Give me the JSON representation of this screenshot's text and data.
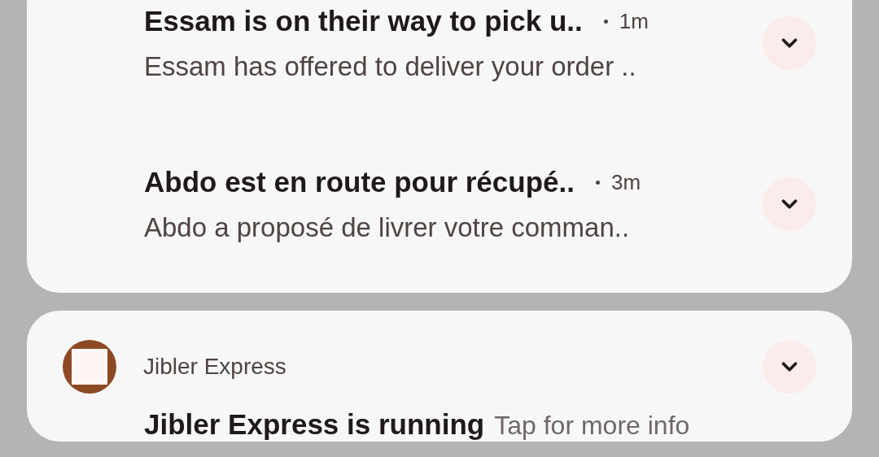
{
  "conversation": {
    "items": [
      {
        "title": "Essam is on their way to pick u..",
        "time": "1m",
        "body": "Essam has offered to deliver your order .."
      },
      {
        "title": "Abdo est en route pour récupé..",
        "time": "3m",
        "body": "Abdo a proposé de livrer votre comman.."
      }
    ]
  },
  "app_notification": {
    "app_name": "Jibler Express",
    "title": "Jibler Express is running",
    "body": "Tap for more info"
  }
}
